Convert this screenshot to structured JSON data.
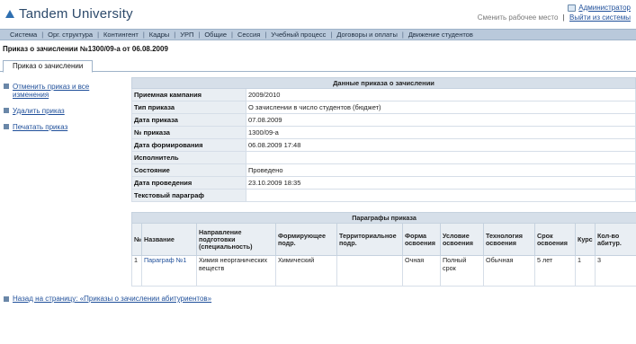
{
  "header": {
    "app_title": "Tandem University",
    "user_name": "Администратор",
    "change_workplace": "Сменить рабочее место",
    "logout": "Выйти из системы"
  },
  "nav": {
    "items": [
      "Система",
      "Орг. структура",
      "Контингент",
      "Кадры",
      "УРП",
      "Общие",
      "Сессия",
      "Учебный процесс",
      "Договоры и оплаты",
      "Движение студентов"
    ]
  },
  "page_title": "Приказ о зачислении №1300/09-а от 06.08.2009",
  "tab_label": "Приказ о зачислении",
  "actions": {
    "cancel": "Отменить приказ и все изменения",
    "delete": "Удалить приказ",
    "print": "Печатать приказ"
  },
  "details": {
    "caption": "Данные приказа о зачислении",
    "rows": [
      {
        "label": "Приемная кампания",
        "value": "2009/2010"
      },
      {
        "label": "Тип приказа",
        "value": "О зачислении в число студентов (бюджет)"
      },
      {
        "label": "Дата приказа",
        "value": "07.08.2009"
      },
      {
        "label": "№ приказа",
        "value": "1300/09-а"
      },
      {
        "label": "Дата формирования",
        "value": "06.08.2009 17:48"
      },
      {
        "label": "Исполнитель",
        "value": ""
      },
      {
        "label": "Состояние",
        "value": "Проведено"
      },
      {
        "label": "Дата проведения",
        "value": "23.10.2009 18:35"
      },
      {
        "label": "Текстовый параграф",
        "value": ""
      }
    ]
  },
  "paragraphs": {
    "caption": "Параграфы приказа",
    "columns": [
      "№",
      "Название",
      "Направление подготовки (специальность)",
      "Формирующее подр.",
      "Территориальное подр.",
      "Форма освоения",
      "Условие освоения",
      "Технология освоения",
      "Срок освоения",
      "Курс",
      "Кол-во абитур."
    ],
    "rows": [
      {
        "num": "1",
        "name": "Параграф №1",
        "direction": "Химия неорганических веществ",
        "forming": "Химический",
        "territorial": "",
        "form": "Очная",
        "condition": "Полный срок",
        "technology": "Обычная",
        "term": "5 лет",
        "course": "1",
        "count": "3"
      }
    ]
  },
  "back_link": "Назад на страницу: «Приказы о зачислении абитуриентов»"
}
